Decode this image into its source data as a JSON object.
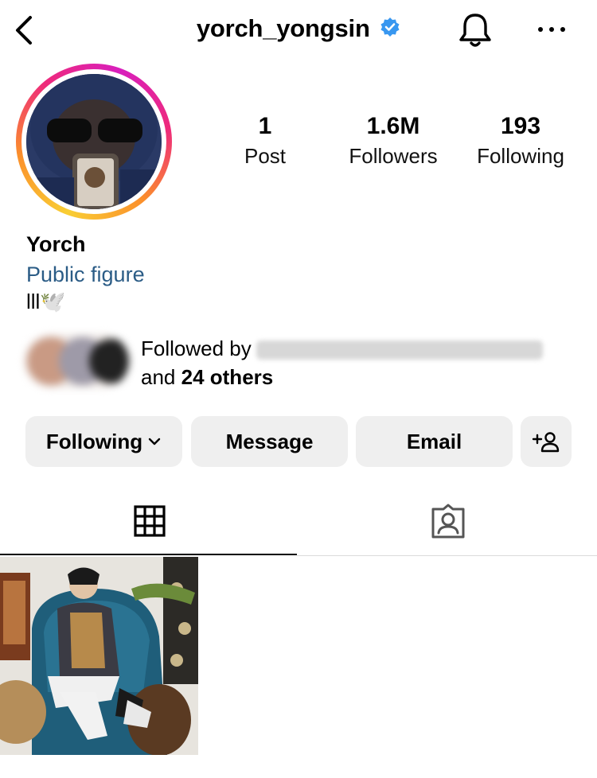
{
  "header": {
    "username": "yorch_yongsin",
    "icons": [
      "back-arrow-icon",
      "verified-badge-icon",
      "bell-icon",
      "more-options-icon"
    ]
  },
  "profile": {
    "display_name": "Yorch",
    "category": "Public figure",
    "bio": "lll🕊️",
    "stats": [
      {
        "value": "1",
        "label": "Post"
      },
      {
        "value": "1.6M",
        "label": "Followers"
      },
      {
        "value": "193",
        "label": "Following"
      }
    ],
    "followed_by": {
      "prefix": "Followed by",
      "and": "and",
      "others": "24 others"
    }
  },
  "actions": {
    "following_label": "Following",
    "message_label": "Message",
    "email_label": "Email",
    "add_person_icon": "add-person-icon"
  },
  "tabs": [
    {
      "name": "grid",
      "icon": "grid-icon",
      "selected": true
    },
    {
      "name": "tagged",
      "icon": "tagged-person-icon",
      "selected": false
    }
  ],
  "colors": {
    "category_link": "#2b5c86",
    "verified_blue": "#3897f0",
    "button_bg": "#efefef"
  }
}
